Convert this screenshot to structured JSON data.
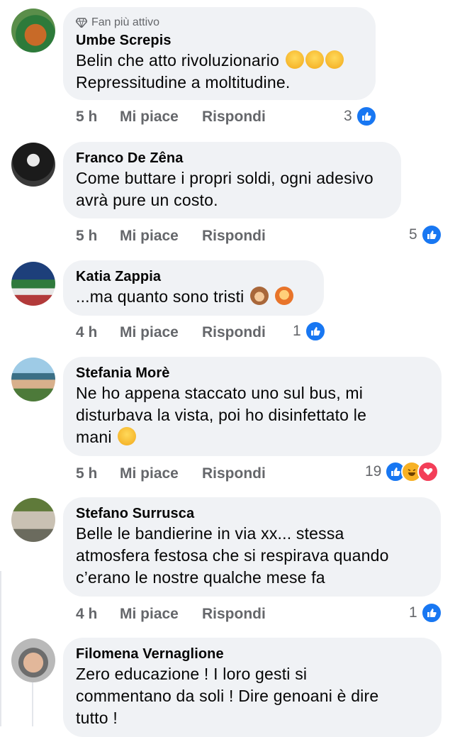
{
  "comments": [
    {
      "badge": "Fan più attivo",
      "author": "Umbe Screpis",
      "lines": [
        "Belin che atto rivoluzionario",
        "Repressitudine a moltitudine."
      ],
      "emoji_after_line1": [
        "rofl-emoji",
        "rofl-emoji",
        "rofl-emoji"
      ],
      "time": "5 h",
      "like": "Mi piace",
      "reply": "Rispondi",
      "reactions": "3"
    },
    {
      "author": "Franco De Zêna",
      "lines": [
        "Come buttare i propri soldi, ogni adesivo",
        "avrà pure un costo."
      ],
      "time": "5 h",
      "like": "Mi piace",
      "reply": "Rispondi",
      "reactions": "5"
    },
    {
      "author": "Katia Zappia",
      "lines": [
        "...ma quanto sono tristi"
      ],
      "time": "4 h",
      "like": "Mi piace",
      "reply": "Rispondi",
      "reactions": "1"
    },
    {
      "author": "Stefania Morè",
      "lines": [
        "Ne ho appena staccato uno sul bus, mi",
        "disturbava la vista, poi ho disinfettato le",
        "mani"
      ],
      "time": "5 h",
      "like": "Mi piace",
      "reply": "Rispondi",
      "reactions": "19"
    },
    {
      "author": "Stefano Surrusca",
      "lines": [
        "Belle le bandierine in via xx... stessa",
        "atmosfera festosa che si respirava quando",
        "c’erano le nostre qualche mese fa"
      ],
      "time": "4 h",
      "like": "Mi piace",
      "reply": "Rispondi",
      "reactions": "1"
    },
    {
      "author": "Filomena Vernaglione",
      "lines": [
        "Zero educazione ! I loro gesti si",
        "commentano da soli ! Dire genoani è dire",
        "tutto !"
      ]
    }
  ],
  "colors": {
    "bubble": "#f0f2f5",
    "like": "#1877f2",
    "haha": "#f7b125",
    "love": "#f33e58",
    "meta": "#65676b"
  }
}
